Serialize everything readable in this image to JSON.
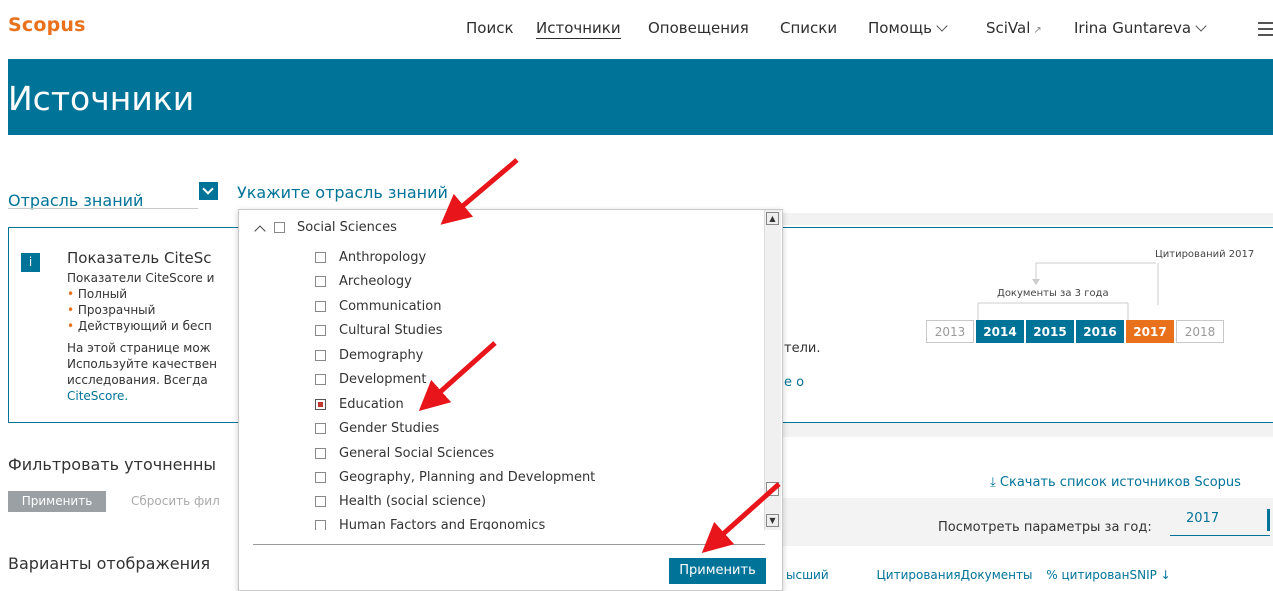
{
  "header": {
    "logo": "Scopus",
    "nav": [
      "Поиск",
      "Источники",
      "Оповещения",
      "Списки",
      "Помощь",
      "SciVal",
      "Irina Guntareva"
    ],
    "active_nav": "Источники"
  },
  "banner": {
    "title": "Источники"
  },
  "subject": {
    "label": "Отрасль знаний",
    "hint": "Укажите отрасль знаний"
  },
  "info": {
    "title": "Показатель CiteSc",
    "line1": "Показатели CiteScore и",
    "bullet1": "Полный",
    "bullet2": "Прозрачный",
    "bullet3": "Действующий и бесп",
    "line5": "На этой странице мож",
    "line6": "Используйте качествен",
    "line7": "исследования. Всегда",
    "link": "CiteScore.",
    "right_text": "тели.",
    "right_link": "е о",
    "cit_label": "Цитирований 2017",
    "doc_label": "Документы за 3 года",
    "years": [
      "2013",
      "2014",
      "2015",
      "2016",
      "2017",
      "2018"
    ]
  },
  "filter": {
    "title": "Фильтровать уточненны",
    "apply": "Применить",
    "reset": "Сбросить фил"
  },
  "download": "Скачать список источников Scopus",
  "year_select": {
    "label": "Посмотреть параметры за год:",
    "value": "2017"
  },
  "display": {
    "title": "Варианты отображения"
  },
  "columns": {
    "c1": "ысший",
    "c2": "ЦитированияДокументы",
    "c3": "% цитирован",
    "c4": "SNIP"
  },
  "dropdown": {
    "header": "Social Sciences",
    "items": [
      {
        "label": "Anthropology",
        "checked": false
      },
      {
        "label": "Archeology",
        "checked": false
      },
      {
        "label": "Communication",
        "checked": false
      },
      {
        "label": "Cultural Studies",
        "checked": false
      },
      {
        "label": "Demography",
        "checked": false
      },
      {
        "label": "Development",
        "checked": false
      },
      {
        "label": "Education",
        "checked": true
      },
      {
        "label": "Gender Studies",
        "checked": false
      },
      {
        "label": "General Social Sciences",
        "checked": false
      },
      {
        "label": "Geography, Planning and Development",
        "checked": false
      },
      {
        "label": "Health (social science)",
        "checked": false
      },
      {
        "label": "Human Factors and Ergonomics",
        "checked": false
      }
    ],
    "apply": "Применить"
  },
  "colors": {
    "brand": "#007398",
    "accent": "#e9711c",
    "arrow": "#e8151b"
  }
}
